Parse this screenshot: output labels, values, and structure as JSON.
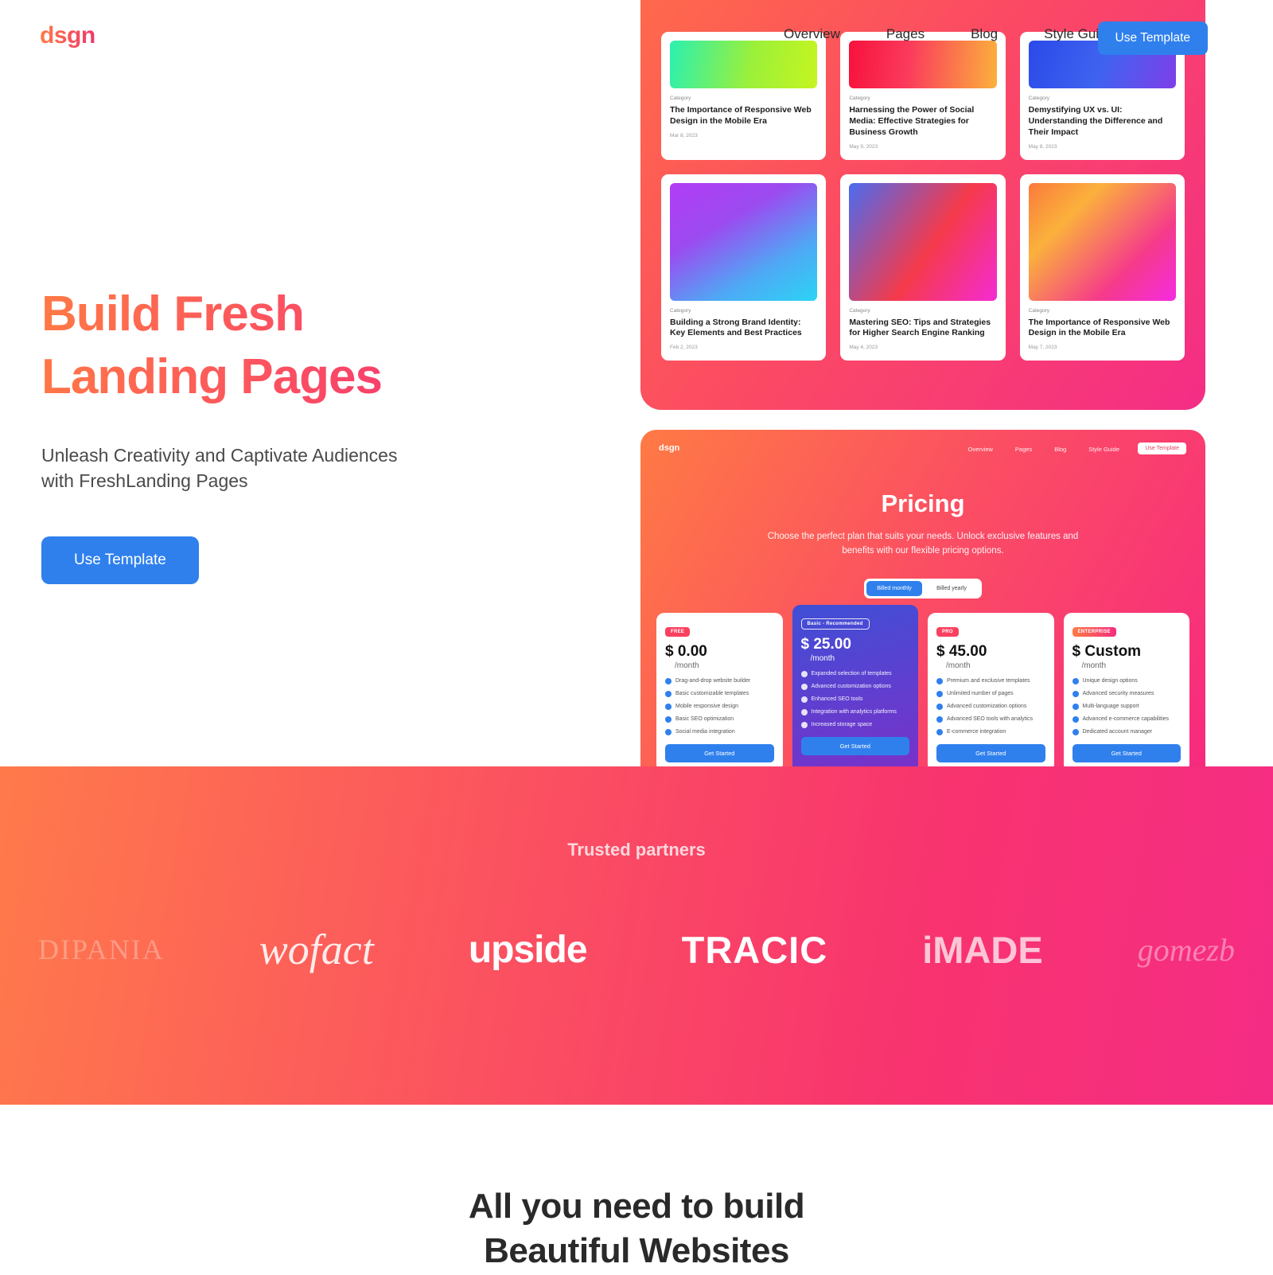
{
  "brand": {
    "logo": "dsgn"
  },
  "nav": {
    "links": [
      "Overview",
      "Pages",
      "Blog",
      "Style Guide"
    ],
    "cta": "Use Template"
  },
  "hero": {
    "title_line1": "Build Fresh",
    "title_line2": "Landing Pages",
    "subtitle": "Unleash Creativity and Captivate Audiences with FreshLanding Pages",
    "cta": "Use Template",
    "accent_start": "#FF7A45",
    "accent_end": "#F0297A",
    "cta_color": "#2F80ED"
  },
  "blog_panel": {
    "cards": [
      {
        "category": "Category",
        "title": "The Importance of Responsive Web Design in the Mobile Era",
        "date": "Mar 8, 2023",
        "gradient": "linear-gradient(100deg, #2BF0B0 0%, #9BF03A 55%, #C6F520 100%)"
      },
      {
        "category": "Category",
        "title": "Harnessing the Power of Social Media: Effective Strategies for Business Growth",
        "date": "May 9, 2023",
        "gradient": "linear-gradient(95deg, #F7123C 0%, #FB3A5C 40%, #FBB13C 100%)"
      },
      {
        "category": "Category",
        "title": "Demystifying UX vs. UI: Understanding the Difference and Their Impact",
        "date": "May 8, 2023",
        "gradient": "linear-gradient(110deg, #2B4AE8 0%, #3F63F0 50%, #7E3FE8 100%)"
      },
      {
        "category": "Category",
        "title": "Building a Strong Brand Identity: Key Elements and Best Practices",
        "date": "Feb 2, 2023",
        "gradient": "linear-gradient(150deg, #B23CF5 0%, #9B4BF0 35%, #4FA8F5 70%, #2BD4F5 100%)"
      },
      {
        "category": "Category",
        "title": "Mastering SEO: Tips and Strategies for Higher Search Engine Ranking",
        "date": "May 4, 2023",
        "gradient": "linear-gradient(125deg, #4B6BF0 0%, #F53A4A 55%, #F52BD4 100%)"
      },
      {
        "category": "Category",
        "title": "The Importance of Responsive Web Design in the Mobile Era",
        "date": "May 7, 2023",
        "gradient": "linear-gradient(135deg, #FB7A3C 0%, #FBB13C 28%, #F53A8A 70%, #F52BE0 100%)"
      }
    ]
  },
  "pricing_preview": {
    "logo": "dsgn",
    "nav_links": [
      "Overview",
      "Pages",
      "Blog",
      "Style Guide"
    ],
    "nav_cta": "Use Template",
    "title": "Pricing",
    "description": "Choose the perfect plan that suits your needs. Unlock exclusive features and benefits with our flexible pricing options.",
    "toggle": {
      "monthly": "Billed monthly",
      "yearly": "Billed yearly",
      "active": "monthly"
    },
    "plans": [
      {
        "badge": "FREE",
        "price": "$ 0.00",
        "period": "/month",
        "features": [
          "Drag-and-drop website builder",
          "Basic customizable templates",
          "Mobile responsive design",
          "Basic SEO optimization",
          "Social media integration"
        ],
        "cta": "Get Started"
      },
      {
        "badge": "Basic - Recommended",
        "price": "$ 25.00",
        "period": "/month",
        "features": [
          "Expanded selection of templates",
          "Advanced customization options",
          "Enhanced SEO tools",
          "Integration with analytics platforms",
          "Increased storage space"
        ],
        "cta": "Get Started"
      },
      {
        "badge": "PRO",
        "price": "$ 45.00",
        "period": "/month",
        "features": [
          "Premium and exclusive templates",
          "Unlimited number of pages",
          "Advanced customization options",
          "Advanced SEO tools with analytics",
          "E-commerce integration"
        ],
        "cta": "Get Started"
      },
      {
        "badge": "ENTERPRISE",
        "price": "$ Custom",
        "period": "/month",
        "features": [
          "Unique design options",
          "Advanced security measures",
          "Multi-language support",
          "Advanced e-commerce capabilities",
          "Dedicated account manager"
        ],
        "cta": "Get Started"
      }
    ]
  },
  "partners": {
    "title": "Trusted partners",
    "logos": [
      "DIPANIA",
      "wofact",
      "upside",
      "TRACIC",
      "iMADE",
      "gomezb"
    ]
  },
  "bottom": {
    "title_line1": "All you need to build",
    "title_line2": "Beautiful Websites"
  }
}
